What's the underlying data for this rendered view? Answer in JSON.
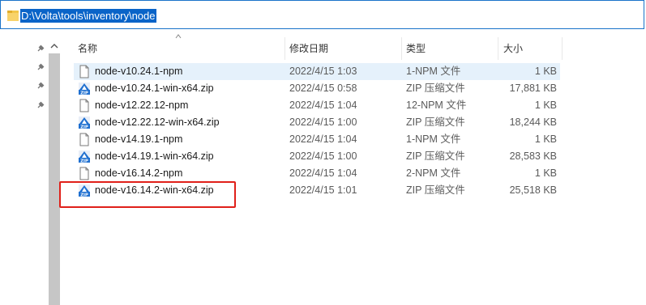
{
  "address_bar": {
    "path": "D:\\Volta\\tools\\inventory\\node"
  },
  "columns": {
    "name": "名称",
    "date": "修改日期",
    "type": "类型",
    "size": "大小"
  },
  "files": [
    {
      "name": "node-v10.24.1-npm",
      "date": "2022/4/15 1:03",
      "type": "1-NPM 文件",
      "size": "1 KB",
      "icon": "file-icon"
    },
    {
      "name": "node-v10.24.1-win-x64.zip",
      "date": "2022/4/15 0:58",
      "type": "ZIP 压缩文件",
      "size": "17,881 KB",
      "icon": "zip-icon"
    },
    {
      "name": "node-v12.22.12-npm",
      "date": "2022/4/15 1:04",
      "type": "12-NPM 文件",
      "size": "1 KB",
      "icon": "file-icon"
    },
    {
      "name": "node-v12.22.12-win-x64.zip",
      "date": "2022/4/15 1:00",
      "type": "ZIP 压缩文件",
      "size": "18,244 KB",
      "icon": "zip-icon"
    },
    {
      "name": "node-v14.19.1-npm",
      "date": "2022/4/15 1:04",
      "type": "1-NPM 文件",
      "size": "1 KB",
      "icon": "file-icon"
    },
    {
      "name": "node-v14.19.1-win-x64.zip",
      "date": "2022/4/15 1:00",
      "type": "ZIP 压缩文件",
      "size": "28,583 KB",
      "icon": "zip-icon"
    },
    {
      "name": "node-v16.14.2-npm",
      "date": "2022/4/15 1:04",
      "type": "2-NPM 文件",
      "size": "1 KB",
      "icon": "file-icon"
    },
    {
      "name": "node-v16.14.2-win-x64.zip",
      "date": "2022/4/15 1:01",
      "type": "ZIP 压缩文件",
      "size": "25,518 KB",
      "icon": "zip-icon"
    }
  ],
  "colors": {
    "selection": "#e5f1fb",
    "highlight_box": "#e0201a",
    "address_selection": "#0a64c8"
  }
}
